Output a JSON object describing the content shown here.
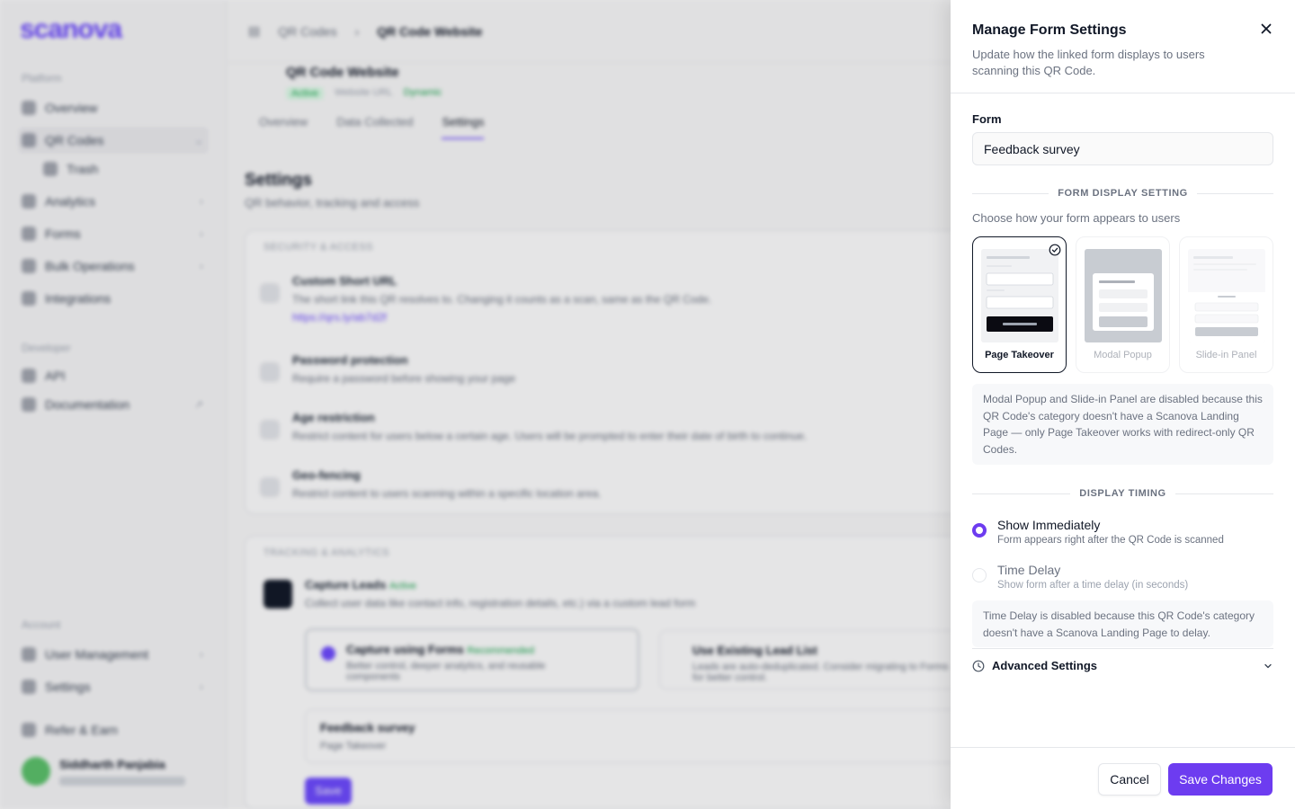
{
  "background": {
    "logo": "scanova",
    "sidebar": {
      "section_platform": "Platform",
      "section_developer": "Developer",
      "section_account": "Account",
      "items": [
        {
          "label": "Overview"
        },
        {
          "label": "QR Codes"
        },
        {
          "label": "Trash"
        },
        {
          "label": "Analytics"
        },
        {
          "label": "Forms"
        },
        {
          "label": "Bulk Operations"
        },
        {
          "label": "Integrations"
        },
        {
          "label": "API"
        },
        {
          "label": "Documentation"
        },
        {
          "label": "User Management"
        },
        {
          "label": "Settings"
        },
        {
          "label": "Refer & Earn"
        }
      ],
      "user_name": "Siddharth Panjabia"
    },
    "breadcrumb": {
      "root": "QR Codes",
      "separator": "›",
      "current": "QR Code Website"
    },
    "page_title": "QR Code Website",
    "tags": {
      "status": "Active",
      "type": "Website URL",
      "mode": "Dynamic"
    },
    "tabs": [
      "Overview",
      "Data Collected",
      "Settings"
    ],
    "settings_title": "Settings",
    "settings_subtitle": "QR behavior, tracking and access",
    "security_label": "SECURITY & ACCESS",
    "rows": [
      {
        "title": "Custom Short URL",
        "desc": "The short link this QR resolves to. Changing it counts as a scan, same as the QR Code.",
        "link": "https://qrs.ly/ab7d2f"
      },
      {
        "title": "Password protection",
        "desc": "Require a password before showing your page"
      },
      {
        "title": "Age restriction",
        "desc": "Restrict content for users below a certain age. Users will be prompted to enter their date of birth to continue."
      },
      {
        "title": "Geo-fencing",
        "desc": "Restrict content to users scanning within a specific location area."
      }
    ],
    "tracking_label": "TRACKING & ANALYTICS",
    "capture": {
      "title": "Capture Leads",
      "badge": "Active",
      "desc": "Collect user data like contact info, registration details, etc.) via a custom lead form"
    },
    "option_forms": {
      "title": "Capture using Forms",
      "badge": "Recommended",
      "desc": "Better control, deeper analytics, and reusable components"
    },
    "option_list": {
      "title": "Use Existing Lead List",
      "desc": "Leads are auto-deduplicated. Consider migrating to Forms for better control."
    },
    "linked_form": {
      "title": "Feedback survey",
      "sub": "Page Takeover"
    },
    "save_small": "Save"
  },
  "drawer": {
    "title": "Manage Form Settings",
    "description": "Update how the linked form displays to users scanning this QR Code.",
    "form_label": "Form",
    "form_value": "Feedback survey",
    "display_setting_header": "FORM DISPLAY SETTING",
    "choose_text": "Choose how your form appears to users",
    "options": [
      {
        "label": "Page Takeover",
        "selected": true,
        "disabled": false
      },
      {
        "label": "Modal Popup",
        "selected": false,
        "disabled": true
      },
      {
        "label": "Slide-in Panel",
        "selected": false,
        "disabled": true
      }
    ],
    "display_info": "Modal Popup and Slide-in Panel are disabled because this QR Code's category doesn't have a Scanova Landing Page — only Page Takeover works with redirect-only QR Codes.",
    "timing_header": "DISPLAY TIMING",
    "timing": [
      {
        "title": "Show Immediately",
        "desc": "Form appears right after the QR Code is scanned",
        "selected": true
      },
      {
        "title": "Time Delay",
        "desc": "Show form after a time delay (in seconds)",
        "selected": false
      }
    ],
    "timing_info": "Time Delay is disabled because this QR Code's category doesn't have a Scanova Landing Page to delay.",
    "advanced_label": "Advanced Settings",
    "cancel_label": "Cancel",
    "save_label": "Save Changes"
  },
  "colors": {
    "accent": "#6d3cf0",
    "brand_logo": "#6d4aff",
    "text_primary": "#111827",
    "text_muted": "#6b7280"
  },
  "icons": [
    "close-icon",
    "checkmark-circle-icon",
    "clock-icon",
    "chevron-down-icon"
  ]
}
